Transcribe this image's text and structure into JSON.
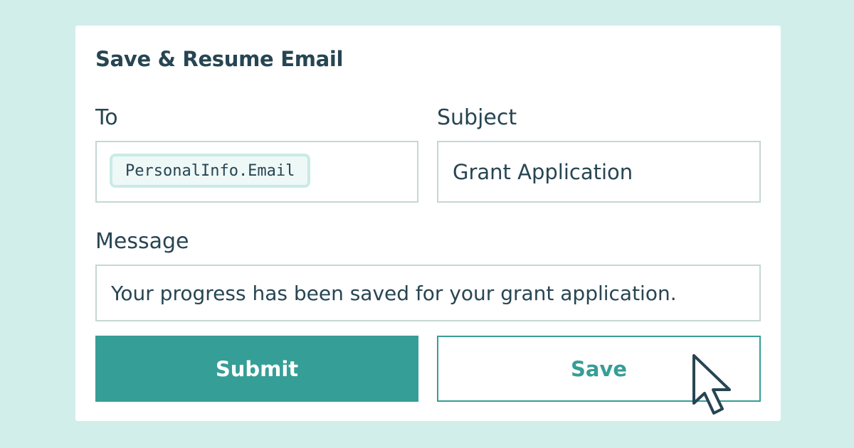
{
  "card": {
    "title": "Save & Resume Email"
  },
  "fields": {
    "to": {
      "label": "To",
      "token": "PersonalInfo.Email"
    },
    "subject": {
      "label": "Subject",
      "value": "Grant Application"
    },
    "message": {
      "label": "Message",
      "value": "Your progress has been saved for your grant application."
    }
  },
  "buttons": {
    "submit_label": "Submit",
    "save_label": "Save"
  },
  "icons": {
    "cursor": "mouse-pointer-icon"
  },
  "colors": {
    "background": "#d1eeeb",
    "card": "#ffffff",
    "text": "#274552",
    "accent": "#359e96",
    "input_border": "#c5d7d4",
    "token_bg": "#eef8f7",
    "token_border": "#c9ebe6"
  }
}
